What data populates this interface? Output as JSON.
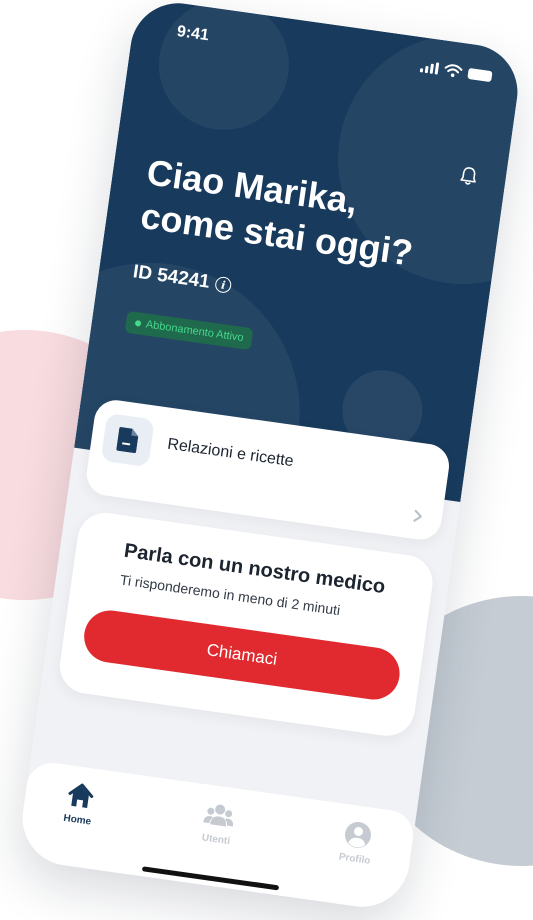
{
  "status_bar": {
    "time": "9:41"
  },
  "header": {
    "greeting": "Ciao Marika,\ncome stai oggi?",
    "id_label": "ID 54241",
    "subscription_badge": "Abbonamento Attivo"
  },
  "cards": {
    "reports_label": "Relazioni e ricette",
    "call": {
      "title": "Parla con un nostro medico",
      "subtitle": "Ti risponderemo in meno di 2 minuti",
      "button_label": "Chiamaci"
    }
  },
  "bottom_nav": {
    "items": [
      {
        "label": "Home",
        "icon": "home-icon",
        "active": true
      },
      {
        "label": "Utenti",
        "icon": "users-icon",
        "active": false
      },
      {
        "label": "Profilo",
        "icon": "profile-icon",
        "active": false
      }
    ]
  },
  "colors": {
    "header_bg": "#183a5c",
    "accent_red": "#e02a2f",
    "badge_green": "#46d88d",
    "deco_pink": "#f9dcdf",
    "deco_grey": "#c5ccd4"
  }
}
